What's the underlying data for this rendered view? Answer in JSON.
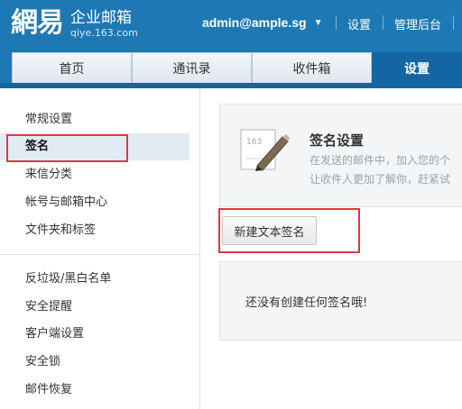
{
  "header": {
    "logo_mark": "網易",
    "logo_title": "企业邮箱",
    "logo_subtitle": "qiye.163.com",
    "user_email": "admin@ample.sg",
    "links": [
      "设置",
      "管理后台"
    ]
  },
  "nav": {
    "tabs": [
      {
        "label": "首页"
      },
      {
        "label": "通讯录"
      },
      {
        "label": "收件箱"
      },
      {
        "label": "设置"
      }
    ],
    "active_tab": "设置"
  },
  "sidebar": {
    "group1": [
      "常规设置",
      "签名",
      "来信分类",
      "帐号与邮箱中心",
      "文件夹和标签"
    ],
    "group2": [
      "反垃圾/黑白名单",
      "安全提醒",
      "客户端设置",
      "安全锁",
      "邮件恢复"
    ],
    "active_item": "签名"
  },
  "signature": {
    "title": "签名设置",
    "desc_line1": "在发送的邮件中，加入您的个",
    "desc_line2": "让收件人更加了解你，赶紧试",
    "icon_label": "163",
    "new_button": "新建文本签名",
    "empty_text": "还没有创建任何签名哦!"
  },
  "colors": {
    "brand_blue": "#1e78b4",
    "active_tab": "#1466a3",
    "highlight_red": "#e0383e"
  }
}
